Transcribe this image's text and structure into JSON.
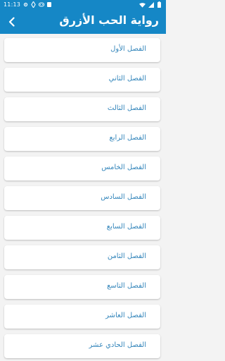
{
  "status_bar": {
    "time": "11:13",
    "left_icons": [
      "android-settings-icon",
      "data-saver-icon",
      "gamepad-icon",
      "app-badge-icon"
    ],
    "right_icons": [
      "wifi-icon",
      "signal-icon",
      "battery-icon"
    ]
  },
  "app_bar": {
    "title": "رواية الحب الأزرق",
    "back_icon": "chevron-left-icon",
    "background": "#1587c6"
  },
  "chapters": [
    {
      "label": "الفصل الأول"
    },
    {
      "label": "الفصل الثاني"
    },
    {
      "label": "الفصل الثالث"
    },
    {
      "label": "الفصل الرابع"
    },
    {
      "label": "الفصل الخامس"
    },
    {
      "label": "الفصل السادس"
    },
    {
      "label": "الفصل السابع"
    },
    {
      "label": "الفصل الثامن"
    },
    {
      "label": "الفصل التاسع"
    },
    {
      "label": "الفصل العاشر"
    },
    {
      "label": "الفصل الحادي عشر"
    }
  ],
  "colors": {
    "accent": "#1587c6",
    "chapter_text": "#3486bb",
    "background": "#f3f3f3"
  }
}
